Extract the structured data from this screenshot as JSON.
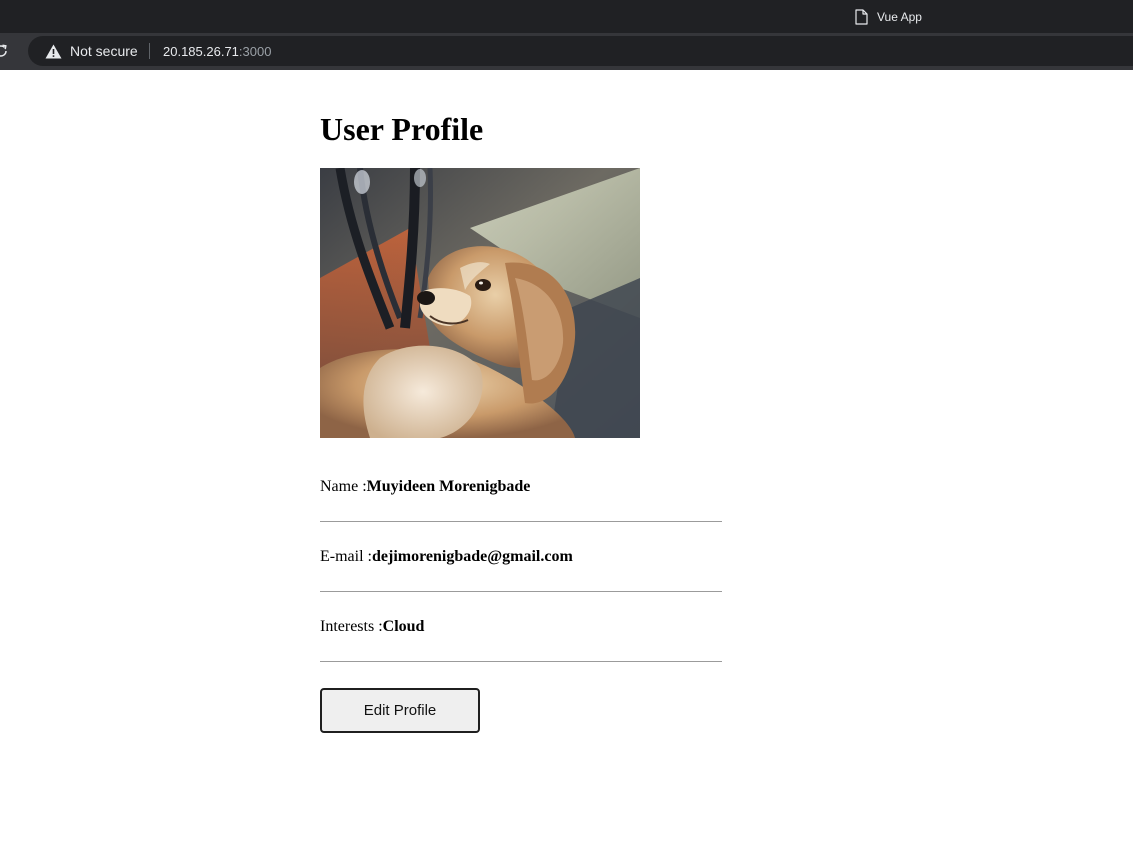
{
  "browser": {
    "tab_title": "Vue App",
    "security_label": "Not secure",
    "url_host": "20.185.26.71",
    "url_port": ":3000"
  },
  "profile": {
    "heading": "User Profile",
    "photo_alt": "dog-photo",
    "fields": [
      {
        "label": "Name :",
        "value": "Muyideen Morenigbade"
      },
      {
        "label": "E-mail :",
        "value": "dejimorenigbade@gmail.com"
      },
      {
        "label": "Interests :",
        "value": "Cloud"
      }
    ],
    "edit_button_label": "Edit Profile"
  },
  "colors": {
    "tabbar_bg": "#202124",
    "toolbar_bg": "#35363a",
    "divider": "#9b9b9b",
    "button_bg": "#efefef"
  }
}
